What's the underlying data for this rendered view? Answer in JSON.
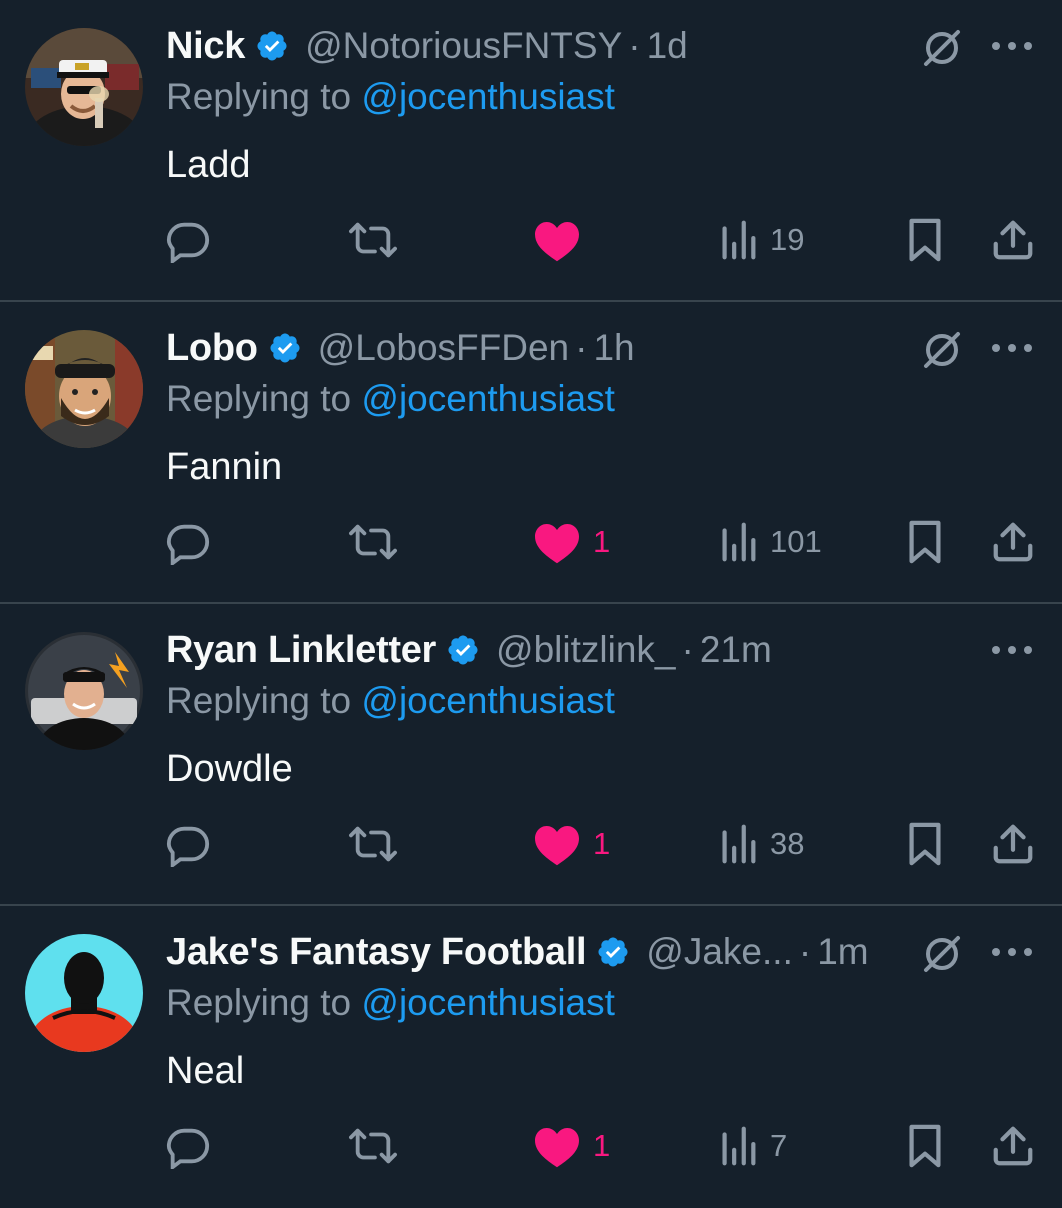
{
  "colors": {
    "background": "#15202b",
    "divider": "#38444d",
    "text_primary": "#f7f9f9",
    "text_secondary": "#8b98a5",
    "link": "#1d9bf0",
    "like": "#f91880",
    "verified": "#1d9bf0"
  },
  "tweets": [
    {
      "display_name": "Nick",
      "handle": "@NotoriousFNTSY",
      "separator": "·",
      "time": "1d",
      "replying_prefix": "Replying to ",
      "replying_to": "@jocenthusiast",
      "text": "Ladd",
      "likes": "",
      "views": "19",
      "verified": true,
      "grok_icon": true,
      "liked": true
    },
    {
      "display_name": "Lobo",
      "handle": "@LobosFFDen",
      "separator": "·",
      "time": "1h",
      "replying_prefix": "Replying to ",
      "replying_to": "@jocenthusiast",
      "text": "Fannin",
      "likes": "1",
      "views": "101",
      "verified": true,
      "grok_icon": true,
      "liked": true
    },
    {
      "display_name": "Ryan Linkletter",
      "handle": "@blitzlink_",
      "separator": "·",
      "time": "21m",
      "replying_prefix": "Replying to ",
      "replying_to": "@jocenthusiast",
      "text": "Dowdle",
      "likes": "1",
      "views": "38",
      "verified": true,
      "grok_icon": false,
      "liked": true
    },
    {
      "display_name": "Jake's Fantasy Football",
      "handle": "@Jake...",
      "separator": "·",
      "time": "1m",
      "replying_prefix": "Replying to ",
      "replying_to": "@jocenthusiast",
      "text": "Neal",
      "likes": "1",
      "views": "7",
      "verified": true,
      "grok_icon": true,
      "liked": true
    }
  ]
}
